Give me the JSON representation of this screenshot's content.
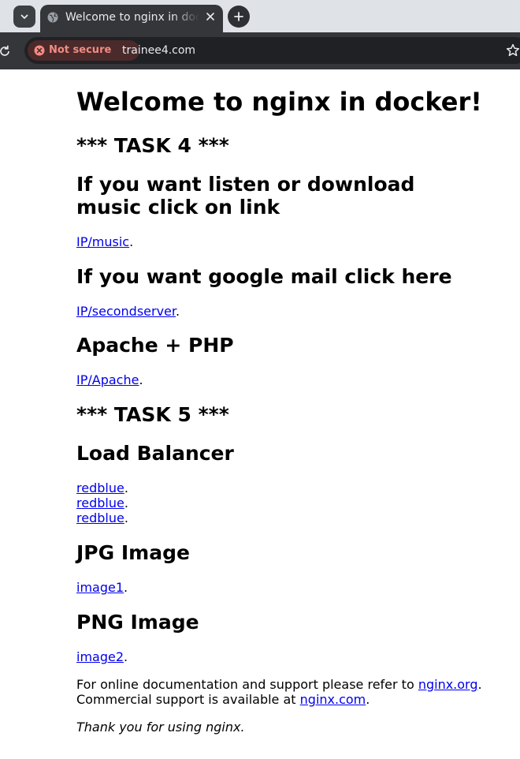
{
  "browser": {
    "tab": {
      "title": "Welcome to nginx in docker!"
    },
    "address_bar": {
      "security_label": "Not secure",
      "url": "trainee4.com"
    }
  },
  "page": {
    "title": "Welcome to nginx in docker!",
    "task4_heading": "*** TASK 4 ***",
    "music": {
      "heading": "If you want listen or download music click on link",
      "link": "IP/music",
      "suffix": "."
    },
    "mail": {
      "heading": "If you want google mail click here",
      "link": "IP/secondserver",
      "suffix": "."
    },
    "apache": {
      "heading": "Apache + PHP",
      "link": "IP/Apache",
      "suffix": "."
    },
    "task5_heading": "*** TASK 5 ***",
    "load_balancer": {
      "heading": "Load Balancer",
      "links": [
        "redblue",
        "redblue",
        "redblue"
      ],
      "suffix": "."
    },
    "jpg": {
      "heading": "JPG Image",
      "link": "image1",
      "suffix": "."
    },
    "png": {
      "heading": "PNG Image",
      "link": "image2",
      "suffix": "."
    },
    "footer": {
      "line1_text": "For online documentation and support please refer to ",
      "line1_link": "nginx.org",
      "line1_end": ".",
      "line2_text": "Commercial support is available at ",
      "line2_link": "nginx.com",
      "line2_end": "."
    },
    "thanks": "Thank you for using nginx."
  },
  "colors": {
    "link": "#0000ee",
    "tab_bg": "#35363a",
    "tabstrip_bg": "#dfe3e7",
    "insecure": "#f28b82"
  }
}
